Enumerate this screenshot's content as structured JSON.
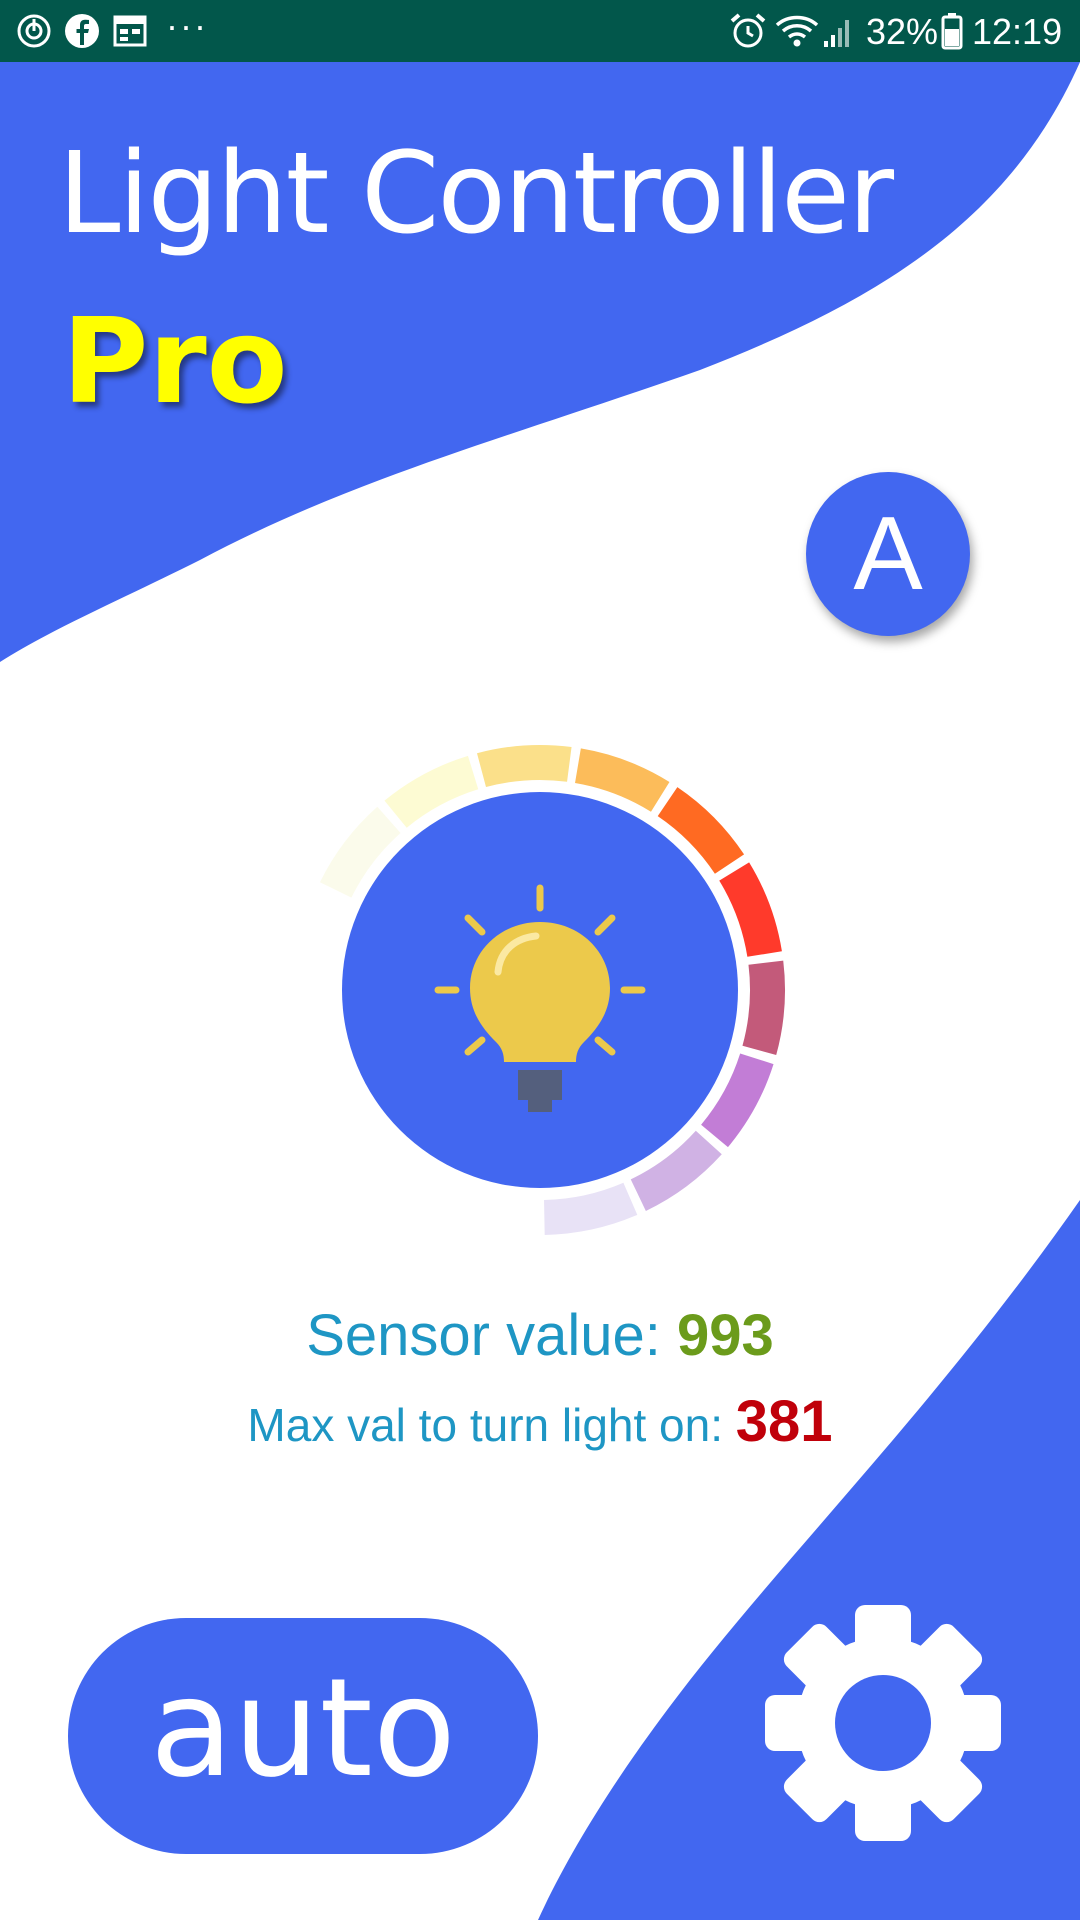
{
  "status_bar": {
    "battery": "32%",
    "time": "12:19",
    "more": "···",
    "left_icons": [
      "sync-icon",
      "facebook-icon",
      "calendar-icon",
      "more-icon"
    ],
    "right_icons": [
      "alarm-icon",
      "wifi-icon",
      "signal-icon",
      "battery-icon"
    ]
  },
  "header": {
    "title": "Light Controller",
    "subtitle": "Pro"
  },
  "mode_badge": {
    "label": "A"
  },
  "gauge": {
    "icon": "lightbulb-icon",
    "segments": 11,
    "segment_colors": [
      "#fbfbeb",
      "#fdfbd3",
      "#fbe08a",
      "#fcbc5a",
      "#ff6a22",
      "#ff3a2b",
      "#c35a7a",
      "#c27dd6",
      "#d0b2e4",
      "#e8e2f6"
    ],
    "colors": {
      "accent": "#4267f0",
      "bulb": "#ecc94b",
      "bulb_base": "#545f7d"
    }
  },
  "readouts": {
    "sensor_label": "Sensor value: ",
    "sensor_value": "993",
    "max_label": "Max val to turn light on: ",
    "max_value": "381"
  },
  "controls": {
    "auto_label": "auto",
    "settings_icon": "gear-icon"
  },
  "colors": {
    "accent": "#4267f0",
    "status_bar": "#02574b",
    "title_pro": "#ffff00",
    "label_text": "#1e96c4",
    "sensor_value": "#6b9b1b",
    "max_value": "#c0000a"
  }
}
